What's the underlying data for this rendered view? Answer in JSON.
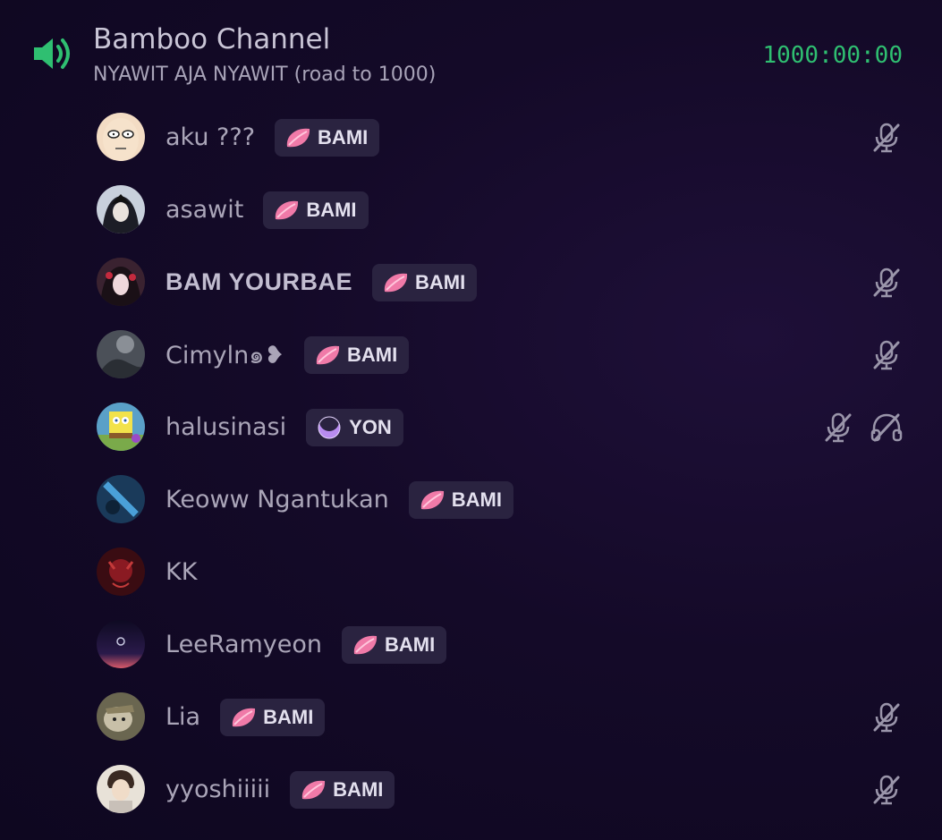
{
  "channel": {
    "name": "Bamboo Channel",
    "topic": "NYAWIT AJA NYAWIT (road to 1000)",
    "timer": "1000:00:00",
    "icon": "speaker-icon",
    "accent_color": "#2fbf71"
  },
  "members": [
    {
      "name": "aku ???",
      "tag": "BAMI",
      "tag_icon": "pink-leaf-icon",
      "muted": true,
      "deafened": false
    },
    {
      "name": "asawit",
      "tag": "BAMI",
      "tag_icon": "pink-leaf-icon",
      "muted": false,
      "deafened": false
    },
    {
      "name": "BAM YOURBAE",
      "tag": "BAMI",
      "tag_icon": "pink-leaf-icon",
      "muted": true,
      "deafened": false
    },
    {
      "name": "Cimyln๑❥",
      "tag": "BAMI",
      "tag_icon": "pink-leaf-icon",
      "muted": true,
      "deafened": false
    },
    {
      "name": "halusinasi",
      "tag": "YON",
      "tag_icon": "purple-moon-icon",
      "muted": true,
      "deafened": true
    },
    {
      "name": "Keoww Ngantukan",
      "tag": "BAMI",
      "tag_icon": "pink-leaf-icon",
      "muted": false,
      "deafened": false
    },
    {
      "name": "KK",
      "tag": "",
      "tag_icon": "",
      "muted": false,
      "deafened": false
    },
    {
      "name": "LeeRamyeon",
      "tag": "BAMI",
      "tag_icon": "pink-leaf-icon",
      "muted": false,
      "deafened": false
    },
    {
      "name": "Lia",
      "tag": "BAMI",
      "tag_icon": "pink-leaf-icon",
      "muted": true,
      "deafened": false
    },
    {
      "name": "yyoshiiiii",
      "tag": "BAMI",
      "tag_icon": "pink-leaf-icon",
      "muted": true,
      "deafened": false
    }
  ]
}
